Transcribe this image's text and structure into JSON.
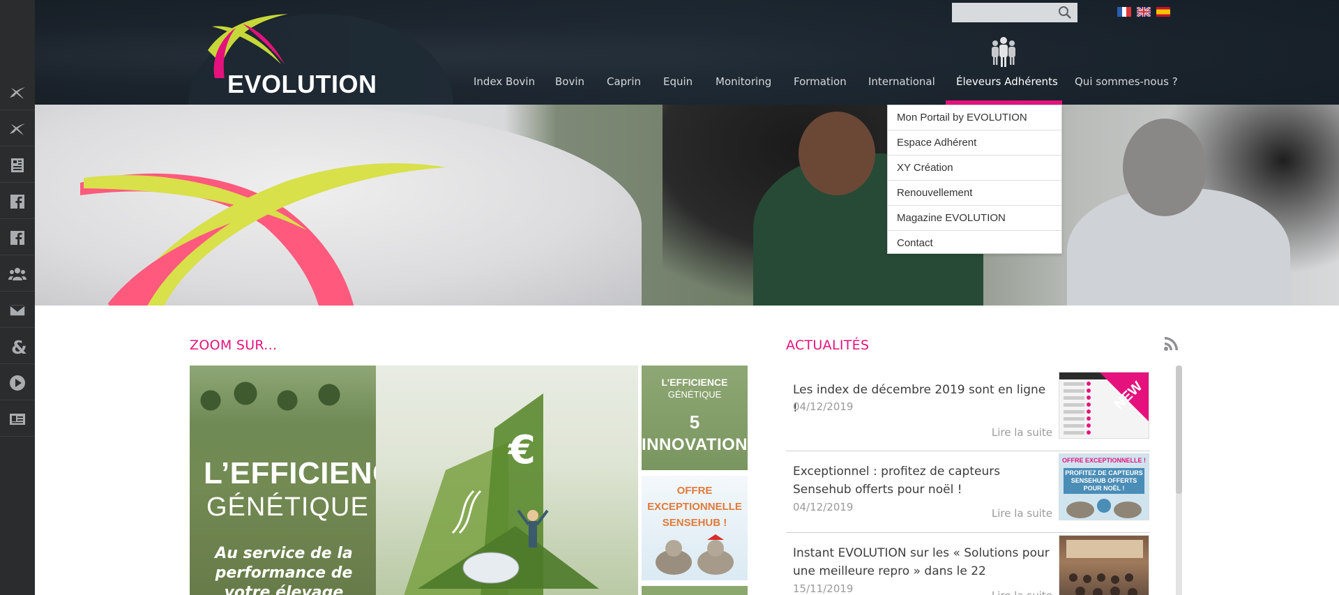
{
  "header": {
    "logo_text": "EVOLUTION",
    "search": {
      "placeholder": "",
      "value": ""
    },
    "flags": [
      "fr-flag",
      "uk-flag",
      "es-flag"
    ],
    "nav": [
      "Index Bovin",
      "Bovin",
      "Caprin",
      "Equin",
      "Monitoring",
      "Formation",
      "International",
      "Éleveurs Adhérents",
      "Qui sommes-nous ?"
    ],
    "active_nav": "Éleveurs Adhérents"
  },
  "dropdown": [
    "Mon Portail by EVOLUTION",
    "Espace Adhérent",
    "XY Création",
    "Renouvellement",
    "Magazine EVOLUTION",
    "Contact"
  ],
  "sidebar": [
    "x-logo-icon",
    "x-logo-icon",
    "news-icon",
    "facebook-icon",
    "facebook-icon",
    "group-icon",
    "mail-icon",
    "ampersand-icon",
    "play-icon",
    "contact-card-icon"
  ],
  "zoom": {
    "title": "ZOOM SUR...",
    "main_title": "L’EFFICIENCE",
    "main_sub": "GÉNÉTIQUE",
    "main_desc": "Au service de la performance de votre élevage",
    "side1": {
      "line1": "L’EFFICIENCE",
      "line2": "GÉNÉTIQUE",
      "line3": "5",
      "line4": "INNOVATIONS"
    },
    "side2": "OFFRE EXCEPTIONNELLE SENSEHUB !"
  },
  "news": {
    "title": "ACTUALITÉS",
    "items": [
      {
        "title": "Les index de décembre 2019 sont en ligne !",
        "date": "04/12/2019",
        "more": "Lire la suite",
        "badge": "NEW"
      },
      {
        "title": "Exceptionnel : profitez de capteurs Sensehub offerts pour noël !",
        "date": "04/12/2019",
        "more": "Lire la suite",
        "badge": "OFFRE EXCEPTIONNELLE !",
        "thumb_text": "PROFITEZ DE CAPTEURS SENSEHUB OFFERTS POUR NOËL !"
      },
      {
        "title": "Instant EVOLUTION sur les « Solutions pour une meilleure repro » dans le 22",
        "date": "15/11/2019",
        "more": "Lire la suite"
      }
    ]
  },
  "colors": {
    "accent": "#e5127d",
    "sidebar": "#2a2c2e",
    "header": "#1e2731"
  }
}
